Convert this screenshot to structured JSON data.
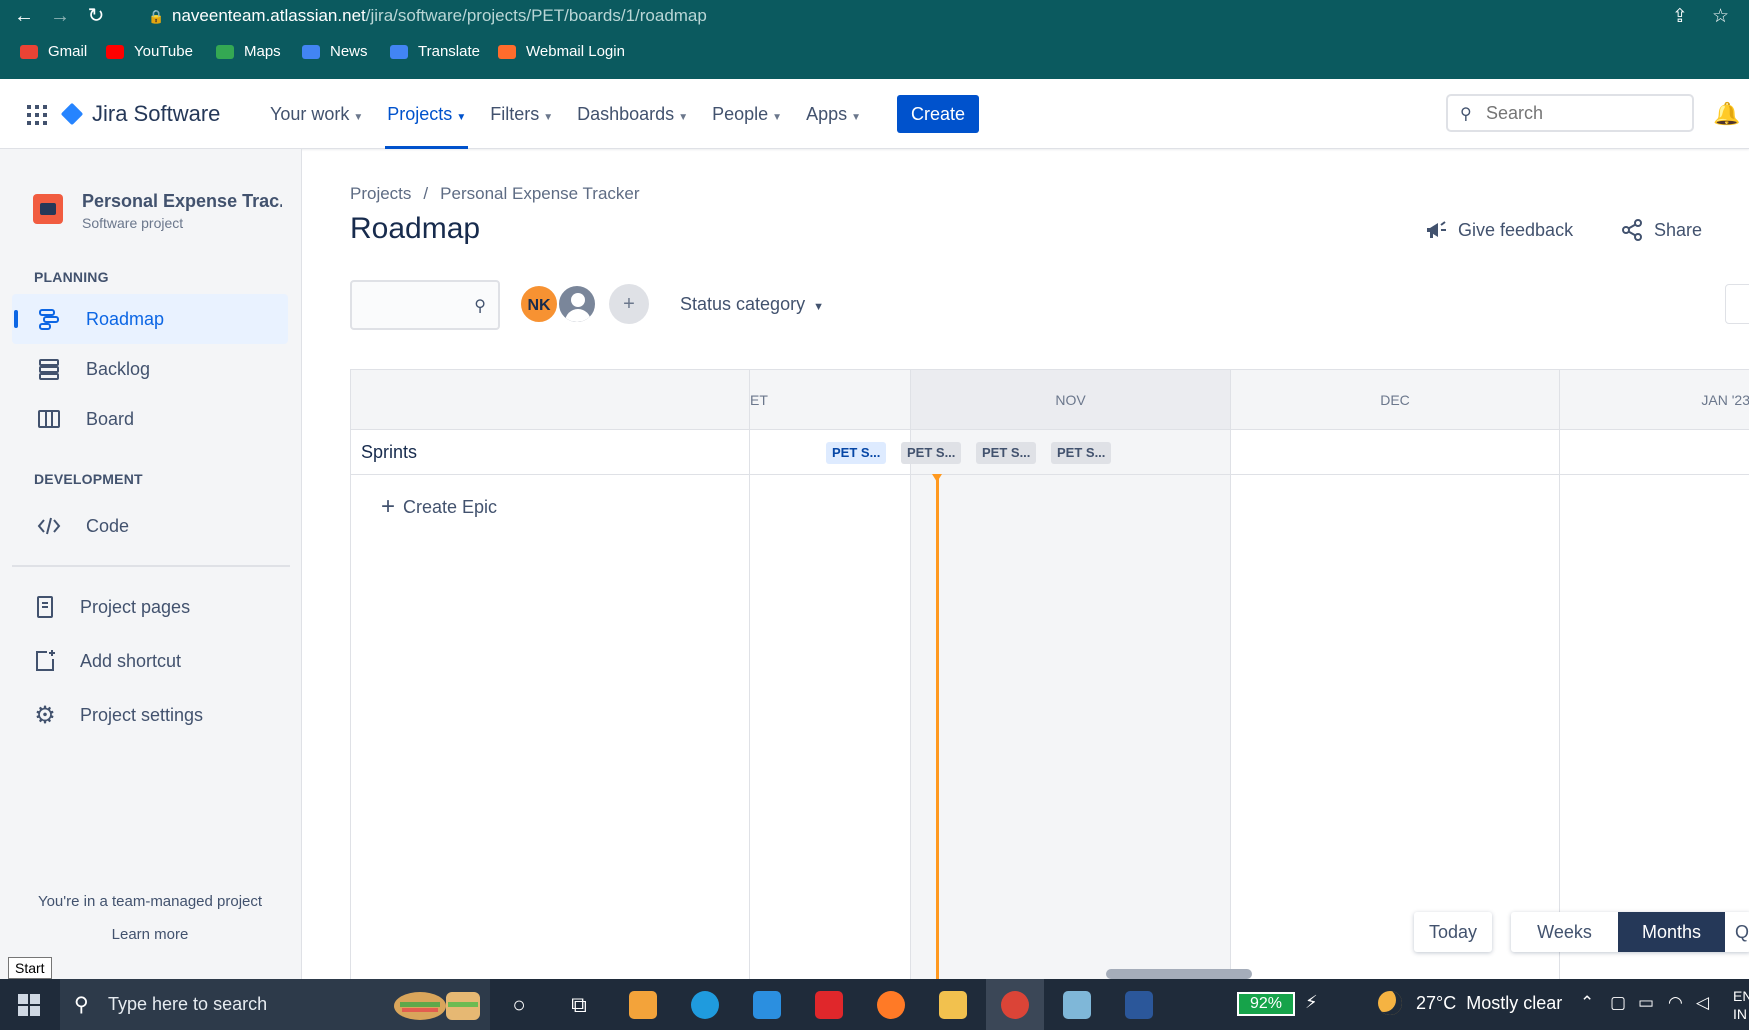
{
  "browser": {
    "url_host": "naveenteam.atlassian.net",
    "url_path": "/jira/software/projects/PET/boards/1/roadmap",
    "bookmarks": [
      "Gmail",
      "YouTube",
      "Maps",
      "News",
      "Translate",
      "Webmail Login"
    ]
  },
  "header": {
    "product": "Jira Software",
    "nav": [
      "Your work",
      "Projects",
      "Filters",
      "Dashboards",
      "People",
      "Apps"
    ],
    "create_label": "Create",
    "search_placeholder": "Search"
  },
  "sidebar": {
    "project_name": "Personal Expense Trac...",
    "project_type": "Software project",
    "planning_title": "PLANNING",
    "planning_items": [
      "Roadmap",
      "Backlog",
      "Board"
    ],
    "development_title": "DEVELOPMENT",
    "development_items": [
      "Code"
    ],
    "bottom_items": [
      "Project pages",
      "Add shortcut",
      "Project settings"
    ],
    "footer_text": "You're in a team-managed project",
    "footer_link": "Learn more"
  },
  "main": {
    "breadcrumb_root": "Projects",
    "breadcrumb_sep": "/",
    "breadcrumb_project": "Personal Expense Tracker",
    "title": "Roadmap",
    "feedback_label": "Give feedback",
    "share_label": "Share",
    "avatar_initials": "NK",
    "status_filter_label": "Status category"
  },
  "roadmap": {
    "months": [
      "ET",
      "NOV",
      "DEC",
      "JAN '23"
    ],
    "sprints_label": "Sprints",
    "sprint_chips": [
      "PET S...",
      "PET S...",
      "PET S...",
      "PET S..."
    ],
    "create_epic_label": "Create Epic",
    "today_label": "Today",
    "view_weeks": "Weeks",
    "view_months": "Months",
    "view_cut": "Q"
  },
  "tooltip": {
    "start": "Start"
  },
  "taskbar": {
    "search_placeholder": "Type here to search",
    "battery": "92%",
    "weather_temp": "27°C",
    "weather_desc": "Mostly clear",
    "lang_line1": "EN",
    "lang_line2": "IN"
  },
  "colors": {
    "browser_chrome": "#0b5a5f",
    "jira_blue": "#0052cc",
    "today_line": "#ff991f",
    "months_active": "#253858"
  }
}
